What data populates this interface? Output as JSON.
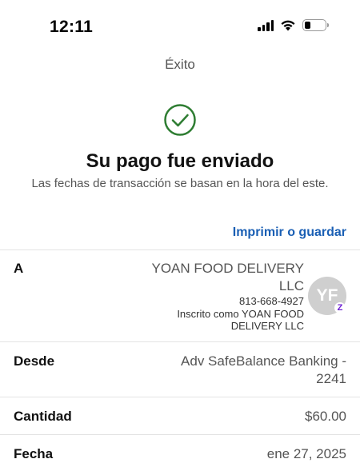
{
  "status_bar": {
    "time": "12:11",
    "battery_level": 0.3
  },
  "nav": {
    "title": "Éxito"
  },
  "success": {
    "icon": "checkmark-circle-icon",
    "color": "#2e7d32"
  },
  "headline": "Su pago fue enviado",
  "subtitle": "Las fechas de transacción se basan en la hora del este.",
  "print_link": "Imprimir o guardar",
  "details": {
    "to": {
      "label": "A",
      "name": "YOAN FOOD DELIVERY LLC",
      "phone": "813-668-4927",
      "enrolled_as": "Inscrito como YOAN FOOD DELIVERY LLC",
      "avatar_initials": "YF",
      "badge": "Z"
    },
    "from": {
      "label": "Desde",
      "value": "Adv SafeBalance Banking - 2241"
    },
    "amount": {
      "label": "Cantidad",
      "value": "$60.00"
    },
    "date": {
      "label": "Fecha",
      "value": "ene 27, 2025"
    }
  },
  "colors": {
    "link": "#1a5fb4",
    "zelle": "#6d1ed4"
  }
}
